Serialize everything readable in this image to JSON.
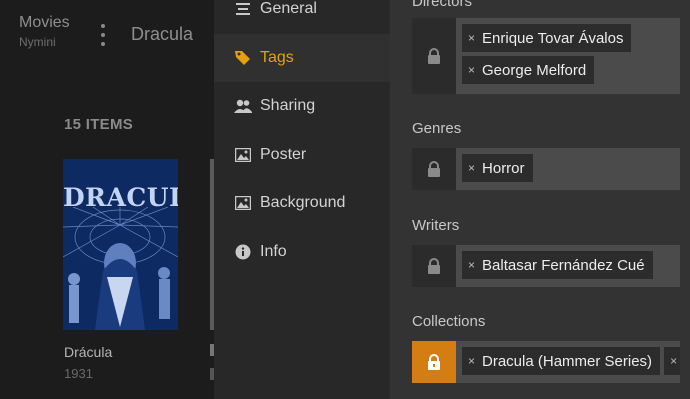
{
  "library": {
    "name": "Movies",
    "server": "Nymini",
    "title": "Dracula",
    "item_count": "15 ITEMS",
    "item": {
      "poster_title": "DRACULA",
      "title": "Drácula",
      "year": "1931"
    }
  },
  "sidebar": {
    "items": [
      {
        "label": "General",
        "icon": "list-icon"
      },
      {
        "label": "Tags",
        "icon": "tag-icon"
      },
      {
        "label": "Sharing",
        "icon": "users-icon"
      },
      {
        "label": "Poster",
        "icon": "image-icon"
      },
      {
        "label": "Background",
        "icon": "image-icon"
      },
      {
        "label": "Info",
        "icon": "info-icon"
      }
    ],
    "active": "Tags"
  },
  "fields": {
    "directors": {
      "label": "Directors",
      "tags": [
        "Enrique Tovar Ávalos",
        "George Melford"
      ],
      "locked": false
    },
    "genres": {
      "label": "Genres",
      "tags": [
        "Horror"
      ],
      "locked": false
    },
    "writers": {
      "label": "Writers",
      "tags": [
        "Baltasar Fernández Cué"
      ],
      "locked": false
    },
    "collections": {
      "label": "Collections",
      "tags": [
        "Dracula (Hammer Series)"
      ],
      "locked": true
    }
  },
  "tag_remove_glyph": "×",
  "colors": {
    "accent": "#e5a00d",
    "lock_active": "#d37d12"
  }
}
